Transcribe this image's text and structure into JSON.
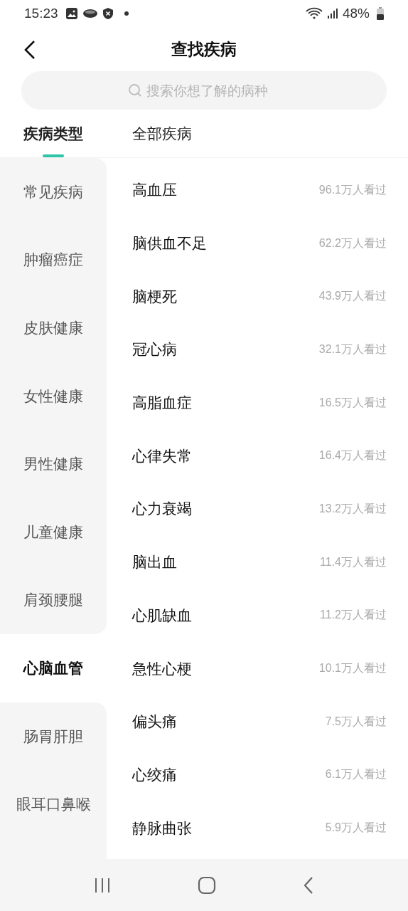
{
  "status_bar": {
    "time": "15:23",
    "battery": "48%"
  },
  "header": {
    "title": "查找疾病"
  },
  "search": {
    "placeholder": "搜索你想了解的病种"
  },
  "tabs": [
    {
      "label": "疾病类型",
      "selected": true
    },
    {
      "label": "全部疾病",
      "selected": false
    }
  ],
  "categories": [
    {
      "label": "常见疾病",
      "selected": false
    },
    {
      "label": "肿瘤癌症",
      "selected": false
    },
    {
      "label": "皮肤健康",
      "selected": false
    },
    {
      "label": "女性健康",
      "selected": false
    },
    {
      "label": "男性健康",
      "selected": false
    },
    {
      "label": "儿童健康",
      "selected": false
    },
    {
      "label": "肩颈腰腿",
      "selected": false
    },
    {
      "label": "心脑血管",
      "selected": true
    },
    {
      "label": "肠胃肝胆",
      "selected": false
    },
    {
      "label": "眼耳口鼻喉",
      "selected": false
    }
  ],
  "diseases": [
    {
      "name": "高血压",
      "views": "96.1万人看过"
    },
    {
      "name": "脑供血不足",
      "views": "62.2万人看过"
    },
    {
      "name": "脑梗死",
      "views": "43.9万人看过"
    },
    {
      "name": "冠心病",
      "views": "32.1万人看过"
    },
    {
      "name": "高脂血症",
      "views": "16.5万人看过"
    },
    {
      "name": "心律失常",
      "views": "16.4万人看过"
    },
    {
      "name": "心力衰竭",
      "views": "13.2万人看过"
    },
    {
      "name": "脑出血",
      "views": "11.4万人看过"
    },
    {
      "name": "心肌缺血",
      "views": "11.2万人看过"
    },
    {
      "name": "急性心梗",
      "views": "10.1万人看过"
    },
    {
      "name": "偏头痛",
      "views": "7.5万人看过"
    },
    {
      "name": "心绞痛",
      "views": "6.1万人看过"
    },
    {
      "name": "静脉曲张",
      "views": "5.9万人看过"
    }
  ]
}
